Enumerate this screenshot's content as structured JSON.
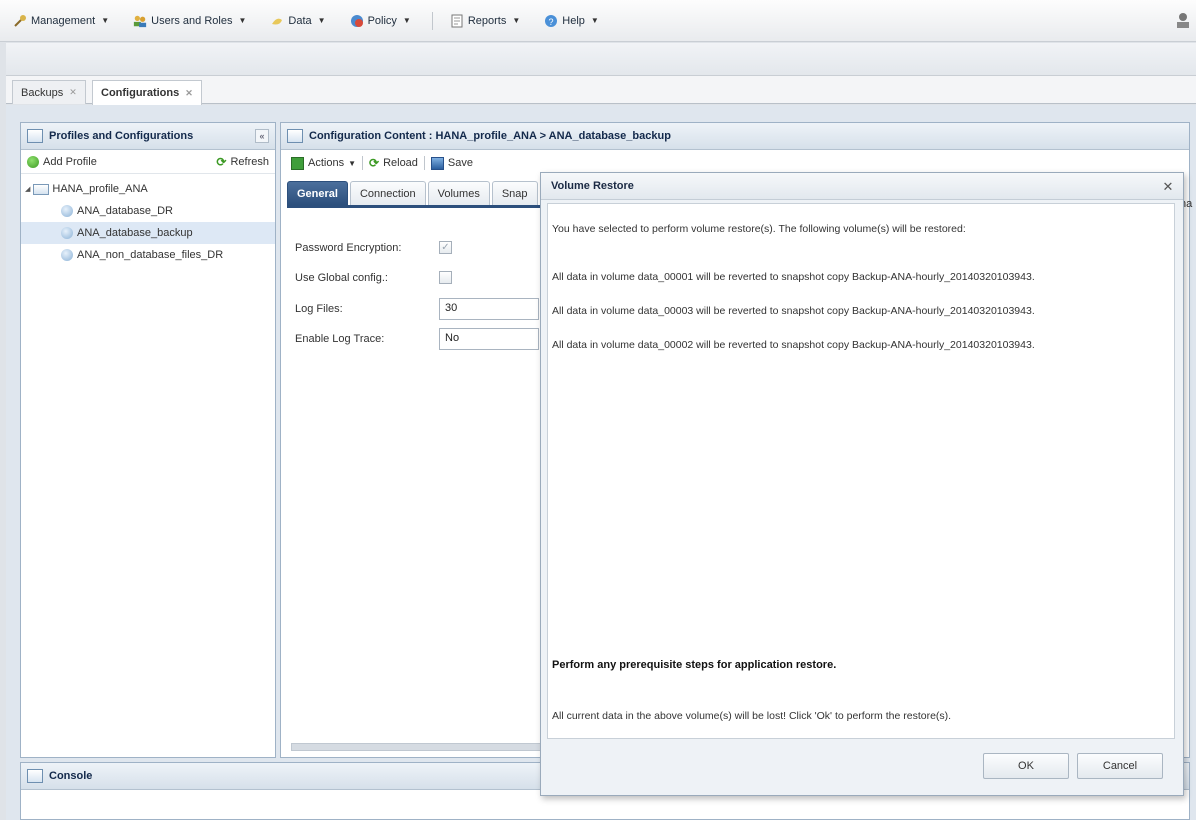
{
  "menubar": {
    "items": [
      {
        "label": "Management",
        "icon": "wrench-icon"
      },
      {
        "label": "Users and Roles",
        "icon": "users-icon"
      },
      {
        "label": "Data",
        "icon": "data-icon"
      },
      {
        "label": "Policy",
        "icon": "policy-icon"
      },
      {
        "label": "Reports",
        "icon": "reports-icon"
      },
      {
        "label": "Help",
        "icon": "help-icon"
      }
    ]
  },
  "apptabs": {
    "backups": "Backups",
    "configurations": "Configurations"
  },
  "left_panel": {
    "title": "Profiles and Configurations",
    "add_profile": "Add Profile",
    "refresh": "Refresh",
    "tree": {
      "root": "HANA_profile_ANA",
      "children": [
        "ANA_database_DR",
        "ANA_database_backup",
        "ANA_non_database_files_DR"
      ]
    }
  },
  "right_panel": {
    "title": "Configuration Content : HANA_profile_ANA > ANA_database_backup",
    "toolbar": {
      "actions": "Actions",
      "reload": "Reload",
      "save": "Save"
    },
    "tabs": [
      "General",
      "Connection",
      "Volumes",
      "Snap"
    ],
    "form": {
      "password_encryption": "Password Encryption:",
      "use_global_config": "Use Global config.:",
      "log_files_label": "Log Files:",
      "log_files_value": "30",
      "enable_log_trace_label": "Enable Log Trace:",
      "enable_log_trace_value": "No"
    },
    "edge_fragment": "ha"
  },
  "console": {
    "title": "Console"
  },
  "dialog": {
    "title": "Volume Restore",
    "intro": "You have selected to perform volume restore(s). The following volume(s) will be restored:",
    "lines": [
      "All data in volume data_00001 will be reverted to snapshot copy Backup-ANA-hourly_20140320103943.",
      "All data in volume data_00003 will be reverted to snapshot copy Backup-ANA-hourly_20140320103943.",
      "All data in volume data_00002 will be reverted to snapshot copy Backup-ANA-hourly_20140320103943."
    ],
    "prereq": "Perform any prerequisite steps for application restore.",
    "warning": "All current data in the above volume(s) will be lost! Click 'Ok' to perform the restore(s).",
    "ok": "OK",
    "cancel": "Cancel"
  }
}
